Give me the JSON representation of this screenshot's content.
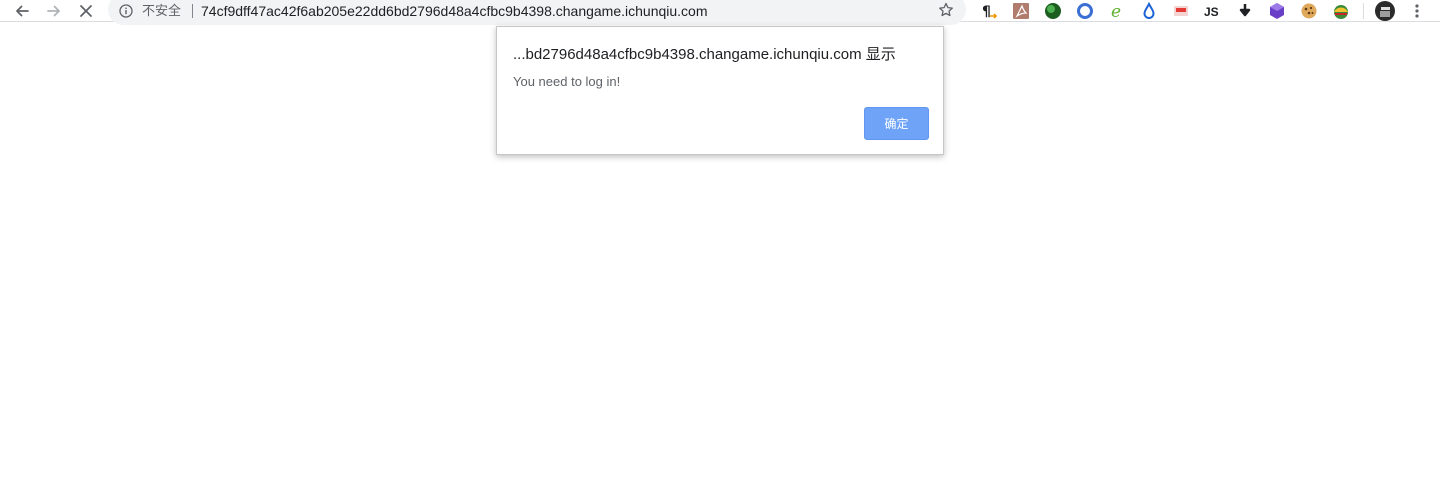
{
  "browser": {
    "security_label": "不安全",
    "url": "74cf9dff47ac42f6ab205e22dd6bd2796d48a4cfbc9b4398.changame.ichunqiu.com",
    "icons": {
      "back": "arrow-left",
      "forward": "arrow-right",
      "stop": "close-x",
      "info": "info-circle",
      "bookmark": "star-outline"
    }
  },
  "extensions": [
    {
      "name": "paragraph-extension",
      "glyph": "¶",
      "color": "#202124"
    },
    {
      "name": "pdf-extension",
      "glyph": "⅄",
      "color": "#ffffff"
    },
    {
      "name": "green-sphere-extension",
      "glyph": "",
      "color": "#2e7d32"
    },
    {
      "name": "blue-ring-extension",
      "glyph": "",
      "color": "#3b6fd4"
    },
    {
      "name": "e-extension",
      "glyph": "e",
      "color": "#5fb233"
    },
    {
      "name": "drop-extension",
      "glyph": "",
      "color": "#1e63d6"
    },
    {
      "name": "red-badge-extension",
      "glyph": "",
      "color": "#e53935"
    },
    {
      "name": "js-extension",
      "glyph": "JS",
      "color": "#202124"
    },
    {
      "name": "download-extension",
      "glyph": "",
      "color": "#202124"
    },
    {
      "name": "purple-cube-extension",
      "glyph": "",
      "color": "#6a3fc8"
    },
    {
      "name": "cookie-extension",
      "glyph": "",
      "color": "#c88a3a"
    },
    {
      "name": "colorful-globe-extension",
      "glyph": "",
      "color": "#3a8a3a"
    }
  ],
  "profile": {
    "icon": "avatar"
  },
  "menu": {
    "icon": "three-dots-vertical"
  },
  "dialog": {
    "title": "...bd2796d48a4cfbc9b4398.changame.ichunqiu.com 显示",
    "message": "You need to log in!",
    "ok_label": "确定"
  }
}
